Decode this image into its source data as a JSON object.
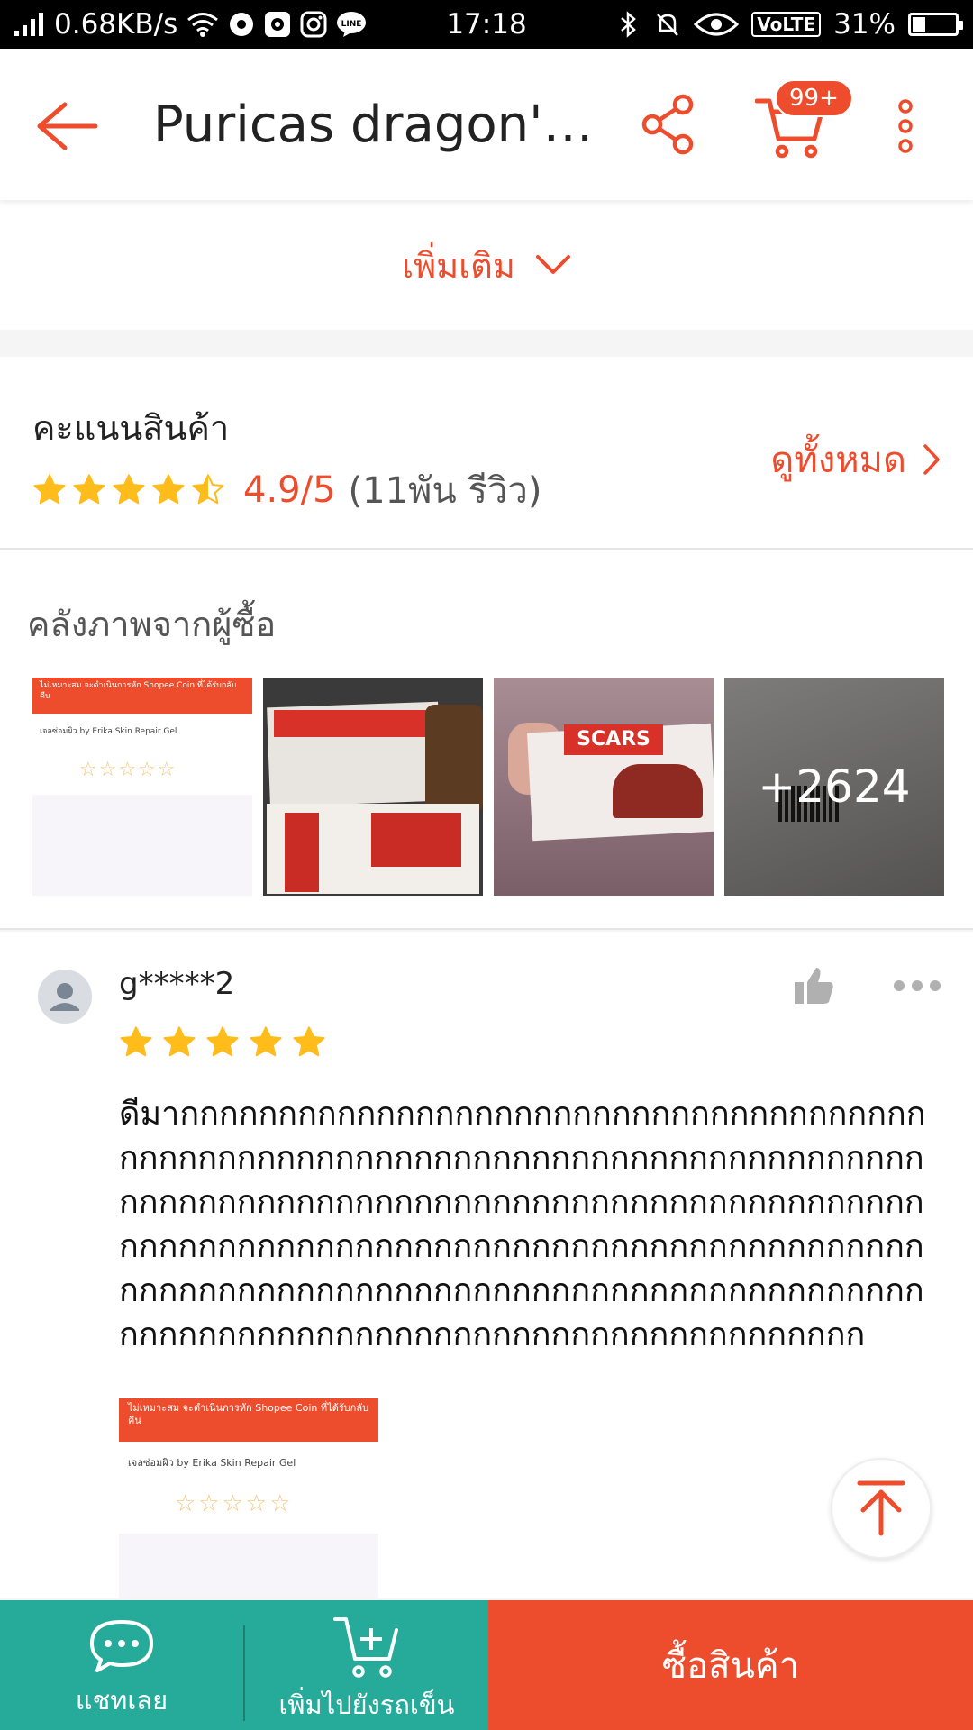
{
  "status_bar": {
    "network_speed": "0.68KB/s",
    "time": "17:18",
    "volte": "VoLTE",
    "battery": "31%",
    "battery_level": 0.31
  },
  "app_bar": {
    "title": "Puricas dragon's...",
    "cart_badge": "99+"
  },
  "more": {
    "label": "เพิ่มเติม"
  },
  "rating": {
    "title": "คะแนนสินค้า",
    "stars": 4.5,
    "score": "4.9/5",
    "count": "(11พัน รีวิว)",
    "see_all": "ดูทั้งหมด"
  },
  "gallery": {
    "title": "คลังภาพจากผู้ซื้อ",
    "more_count": "+2624",
    "thumb1": {
      "banner": "ไม่เหมาะสม จะดำเนินการหัก Shopee Coin ที่ได้รับกลับคืน",
      "product": "เจลซ่อมผิว by Erika Skin Repair Gel"
    },
    "thumb3_label": "SCARS"
  },
  "review": {
    "username": "g*****2",
    "stars": 5,
    "text": "ดีมากกกกกกกกกกกกกกกกกกกกกกกกกกกกกกกกกกกกกกกกกกกกกกกกกกกกกกกกกกกกกกกกกกกกกกกกกกกกกกกกกกกกกกกกกกกกกกกกกกกกกกกกกกกกกกกกกกกกกกกกกกกกกกกกกกกกกกกกกกกกกกกกกกกกกกกกกกกกกกกกกกกกกกกกกกกกกกกกกกกกกกกกกกกกกกกกกกกกกกกกกกกกกกกกกกกกกกกกกกกกกกกกกกกกกกกกกกกกกกกก",
    "photo": {
      "banner": "ไม่เหมาะสม จะดำเนินการหัก Shopee Coin ที่ได้รับกลับคืน",
      "product": "เจลซ่อมผิว by Erika Skin Repair Gel"
    }
  },
  "bottom_bar": {
    "chat_label": "แชทเลย",
    "add_cart_label": "เพิ่มไปยังรถเข็น",
    "buy_label": "ซื้อสินค้า"
  },
  "colors": {
    "brand": "#ee4d2d",
    "teal": "#26aa99",
    "star": "#ffbc1b"
  }
}
